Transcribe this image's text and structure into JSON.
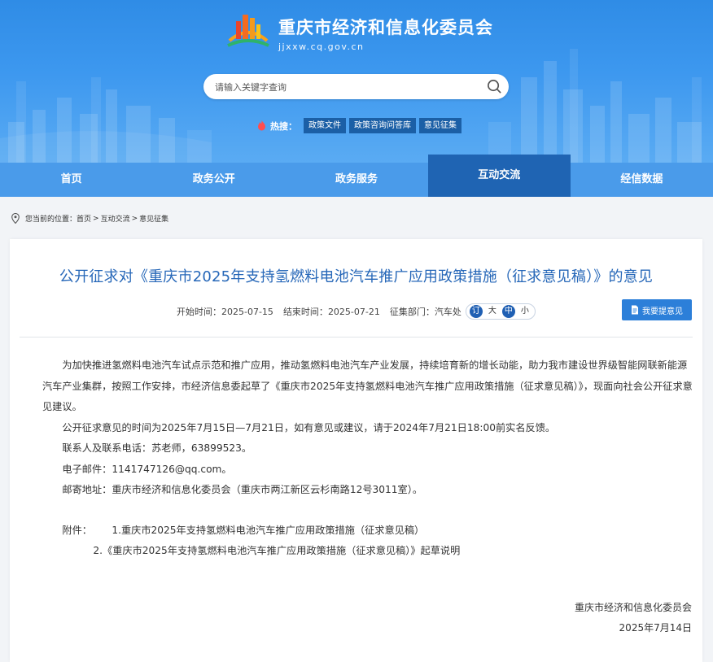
{
  "header": {
    "site_title": "重庆市经济和信息化委员会",
    "site_domain": "jjxxw.cq.gov.cn",
    "search_placeholder": "请输入关键字查询",
    "hot_label": "热搜：",
    "hot_tags": [
      "政策文件",
      "政策咨询问答库",
      "意见征集"
    ]
  },
  "nav": {
    "items": [
      "首页",
      "政务公开",
      "政务服务",
      "互动交流",
      "经信数据"
    ],
    "active": "互动交流"
  },
  "breadcrumb": {
    "prefix": "您当前的位置：",
    "items": [
      "首页",
      "互动交流",
      "意见征集"
    ],
    "separator": ">"
  },
  "article": {
    "title": "公开征求对《重庆市2025年支持氢燃料电池汽车推广应用政策措施（征求意见稿）》的意见",
    "start_label": "开始时间：",
    "start_date": "2025-07-15",
    "end_label": "结束时间：",
    "end_date": "2025-07-21",
    "dept_label": "征集部门：",
    "dept": "汽车处",
    "font_sizes": [
      "订",
      "大",
      "中",
      "小"
    ],
    "feedback_button": "我要提意见",
    "paragraph1": "为加快推进氢燃料电池汽车试点示范和推广应用，推动氢燃料电池汽车产业发展，持续培育新的增长动能，助力我市建设世界级智能网联新能源汽车产业集群，按照工作安排，市经济信息委起草了《重庆市2025年支持氢燃料电池汽车推广应用政策措施（征求意见稿）》，现面向社会公开征求意见建议。",
    "paragraph2": "公开征求意见的时间为2025年7月15日—7月21日，如有意见或建议，请于2024年7月21日18:00前实名反馈。",
    "contact": "联系人及联系电话：苏老师，63899523。",
    "email": "电子邮件：1141747126@qq.com。",
    "address": "邮寄地址：重庆市经济和信息化委员会（重庆市两江新区云杉南路12号3011室）。",
    "attach_label": "附件：",
    "attachments": [
      "1.重庆市2025年支持氢燃料电池汽车推广应用政策措施（征求意见稿）",
      "2.《重庆市2025年支持氢燃料电池汽车推广应用政策措施（征求意见稿）》起草说明"
    ],
    "signature": "重庆市经济和信息化委员会",
    "sign_date": "2025年7月14日"
  },
  "colors": {
    "header_blue": "#3d98ef",
    "nav_active": "#1f64b3",
    "title_blue": "#2667b8",
    "button_blue": "#2c7fd9"
  },
  "icons": {
    "logo": "emblem-logo-icon",
    "search": "search-icon",
    "hot": "flame-icon",
    "location": "location-pin-icon",
    "feedback": "document-icon"
  }
}
